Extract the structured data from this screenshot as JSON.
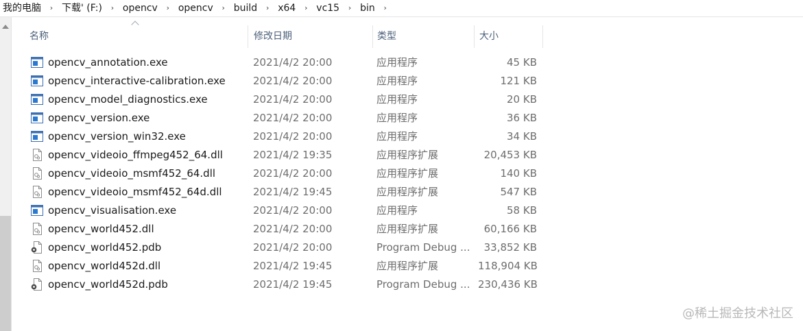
{
  "breadcrumb": [
    "我的电脑",
    "下载' (F:)",
    "opencv",
    "opencv",
    "build",
    "x64",
    "vc15",
    "bin"
  ],
  "columns": {
    "name": "名称",
    "date": "修改日期",
    "type": "类型",
    "size": "大小"
  },
  "files": [
    {
      "name": "opencv_annotation.exe",
      "date": "2021/4/2 20:00",
      "type": "应用程序",
      "size": "45 KB",
      "icon": "exe"
    },
    {
      "name": "opencv_interactive-calibration.exe",
      "date": "2021/4/2 20:00",
      "type": "应用程序",
      "size": "121 KB",
      "icon": "exe"
    },
    {
      "name": "opencv_model_diagnostics.exe",
      "date": "2021/4/2 20:00",
      "type": "应用程序",
      "size": "20 KB",
      "icon": "exe"
    },
    {
      "name": "opencv_version.exe",
      "date": "2021/4/2 20:00",
      "type": "应用程序",
      "size": "36 KB",
      "icon": "exe"
    },
    {
      "name": "opencv_version_win32.exe",
      "date": "2021/4/2 20:00",
      "type": "应用程序",
      "size": "34 KB",
      "icon": "exe"
    },
    {
      "name": "opencv_videoio_ffmpeg452_64.dll",
      "date": "2021/4/2 19:35",
      "type": "应用程序扩展",
      "size": "20,453 KB",
      "icon": "dll"
    },
    {
      "name": "opencv_videoio_msmf452_64.dll",
      "date": "2021/4/2 20:00",
      "type": "应用程序扩展",
      "size": "140 KB",
      "icon": "dll"
    },
    {
      "name": "opencv_videoio_msmf452_64d.dll",
      "date": "2021/4/2 19:45",
      "type": "应用程序扩展",
      "size": "547 KB",
      "icon": "dll"
    },
    {
      "name": "opencv_visualisation.exe",
      "date": "2021/4/2 20:00",
      "type": "应用程序",
      "size": "58 KB",
      "icon": "exe"
    },
    {
      "name": "opencv_world452.dll",
      "date": "2021/4/2 20:00",
      "type": "应用程序扩展",
      "size": "60,166 KB",
      "icon": "dll"
    },
    {
      "name": "opencv_world452.pdb",
      "date": "2021/4/2 20:00",
      "type": "Program Debug ...",
      "size": "33,852 KB",
      "icon": "pdb"
    },
    {
      "name": "opencv_world452d.dll",
      "date": "2021/4/2 19:45",
      "type": "应用程序扩展",
      "size": "118,904 KB",
      "icon": "dll"
    },
    {
      "name": "opencv_world452d.pdb",
      "date": "2021/4/2 19:45",
      "type": "Program Debug ...",
      "size": "230,436 KB",
      "icon": "pdb"
    }
  ],
  "watermark": "@稀土掘金技术社区"
}
